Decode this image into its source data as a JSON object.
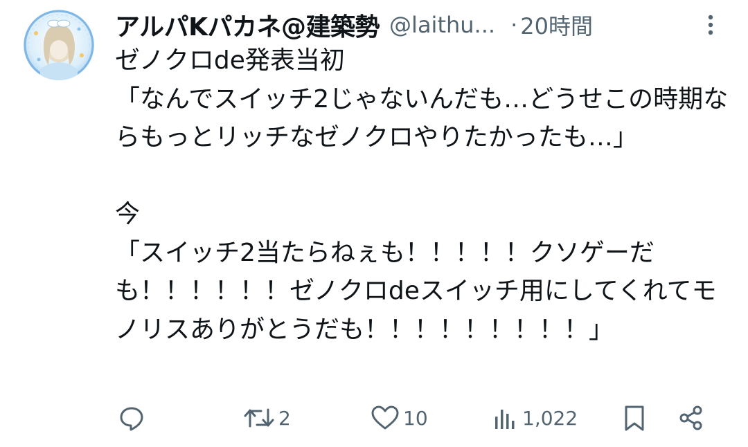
{
  "post": {
    "display_name": "アルパKパカネ@建築勢",
    "handle": "@laithu...",
    "separator": "·",
    "time": "20時間",
    "text": "ゼノクロde発表当初\n「なんでスイッチ2じゃないんだも…どうせこの時期ならもっとリッチなゼノクロやりたかったも…」\n\n今\n「スイッチ2当たらねぇも！！！！！クソゲーだも！！！！！！ゼノクロdeスイッチ用にしてくれてモノリスありがとうだも！！！！！！！！！」"
  },
  "actions": {
    "reply": {
      "icon": "reply-icon",
      "count": ""
    },
    "repost": {
      "icon": "repost-icon",
      "count": "2"
    },
    "like": {
      "icon": "heart-icon",
      "count": "10"
    },
    "views": {
      "icon": "views-icon",
      "count": "1,022"
    },
    "bookmark": {
      "icon": "bookmark-icon"
    },
    "share": {
      "icon": "share-icon"
    }
  },
  "colors": {
    "text": "#0f1419",
    "secondary": "#536471",
    "background": "#ffffff"
  }
}
